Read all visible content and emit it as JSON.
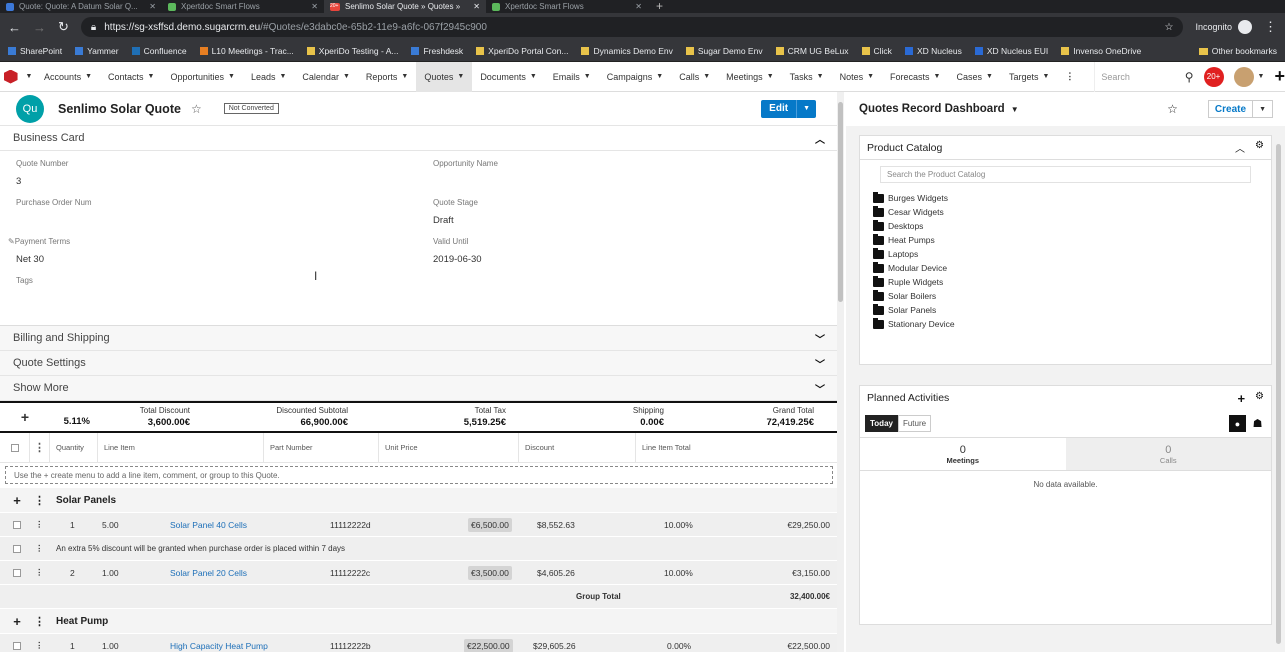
{
  "browser": {
    "tabs": [
      {
        "label": "Quote: Quote: A Datum Solar Q...",
        "color": "#3c78d8"
      },
      {
        "label": "Xpertdoc Smart Flows",
        "color": "#5cb85c"
      },
      {
        "label": "Senlimo Solar Quote » Quotes »",
        "color": "#e8453c",
        "fav_text": "20+"
      },
      {
        "label": "Xpertdoc Smart Flows",
        "color": "#5cb85c"
      }
    ],
    "url_host": "https://sg-xsffsd.demo.sugarcrm.eu",
    "url_path": "/#Quotes/e3dabc0e-65b2-11e9-a6fc-067f2945c900",
    "incognito": "Incognito",
    "bookmarks": [
      "SharePoint",
      "Yammer",
      "Confluence",
      "L10 Meetings - Trac...",
      "XperiDo Testing - A...",
      "Freshdesk",
      "XperiDo Portal Con...",
      "Dynamics Demo Env",
      "Sugar Demo Env",
      "CRM UG BeLux",
      "Click",
      "XD Nucleus",
      "XD Nucleus EUI",
      "Invenso OneDrive"
    ],
    "other_bookmarks": "Other bookmarks"
  },
  "nav": {
    "items": [
      "Accounts",
      "Contacts",
      "Opportunities",
      "Leads",
      "Calendar",
      "Reports",
      "Quotes",
      "Documents",
      "Emails",
      "Campaigns",
      "Calls",
      "Meetings",
      "Tasks",
      "Notes",
      "Forecasts",
      "Cases",
      "Targets"
    ],
    "active": "Quotes",
    "search_placeholder": "Search",
    "notif_count": "20+"
  },
  "record": {
    "avatar": "Qu",
    "title": "Senlimo Solar Quote",
    "status": "Not Converted",
    "edit_label": "Edit"
  },
  "business_card": {
    "section": "Business Card",
    "quote_number_label": "Quote Number",
    "quote_number": "3",
    "opportunity_label": "Opportunity Name",
    "opportunity": "",
    "po_label": "Purchase Order Num",
    "po": "",
    "stage_label": "Quote Stage",
    "stage": "Draft",
    "terms_label": "Payment Terms",
    "terms": "Net 30",
    "valid_label": "Valid Until",
    "valid": "2019-06-30",
    "tags_label": "Tags"
  },
  "sections": {
    "billing": "Billing and Shipping",
    "settings": "Quote Settings",
    "more": "Show More"
  },
  "totals": {
    "pct": "5.11%",
    "discount_label": "Total Discount",
    "discount": "3,600.00€",
    "subtotal_label": "Discounted Subtotal",
    "subtotal": "66,900.00€",
    "tax_label": "Total Tax",
    "tax": "5,519.25€",
    "shipping_label": "Shipping",
    "shipping": "0.00€",
    "grand_label": "Grand Total",
    "grand": "72,419.25€"
  },
  "lines": {
    "headers": [
      "Quantity",
      "Line Item",
      "Part Number",
      "Unit Price",
      "Discount",
      "Line Item Total"
    ],
    "hint": "Use the + create menu to add a line item, comment, or group to this Quote.",
    "group1": "Solar Panels",
    "row1": {
      "n": "1",
      "qty": "5.00",
      "item": "Solar Panel 40 Cells",
      "part": "11112222d",
      "unit": "€6,500.00",
      "list": "$8,552.63",
      "disc": "10.00%",
      "total": "€29,250.00"
    },
    "comment": "An extra 5% discount will be granted when purchase order is placed within 7 days",
    "row2": {
      "n": "2",
      "qty": "1.00",
      "item": "Solar Panel 20 Cells",
      "part": "11112222c",
      "unit": "€3,500.00",
      "list": "$4,605.26",
      "disc": "10.00%",
      "total": "€3,150.00"
    },
    "group_total_label": "Group Total",
    "group_total": "32,400.00€",
    "group2": "Heat Pump",
    "row3": {
      "n": "1",
      "qty": "1.00",
      "item": "High Capacity Heat Pump",
      "part": "11112222b",
      "unit": "€22,500.00",
      "list": "$29,605.26",
      "disc": "0.00%",
      "total": "€22,500.00"
    }
  },
  "dashboard": {
    "title": "Quotes Record Dashboard",
    "create_label": "Create",
    "catalog_title": "Product Catalog",
    "catalog_search": "Search the Product Catalog",
    "categories": [
      "Burges Widgets",
      "Cesar Widgets",
      "Desktops",
      "Heat Pumps",
      "Laptops",
      "Modular Device",
      "Ruple Widgets",
      "Solar Boilers",
      "Solar Panels",
      "Stationary Device"
    ],
    "activities_title": "Planned Activities",
    "tab_today": "Today",
    "tab_future": "Future",
    "meetings_count": "0",
    "meetings_label": "Meetings",
    "calls_count": "0",
    "calls_label": "Calls",
    "empty": "No data available."
  }
}
